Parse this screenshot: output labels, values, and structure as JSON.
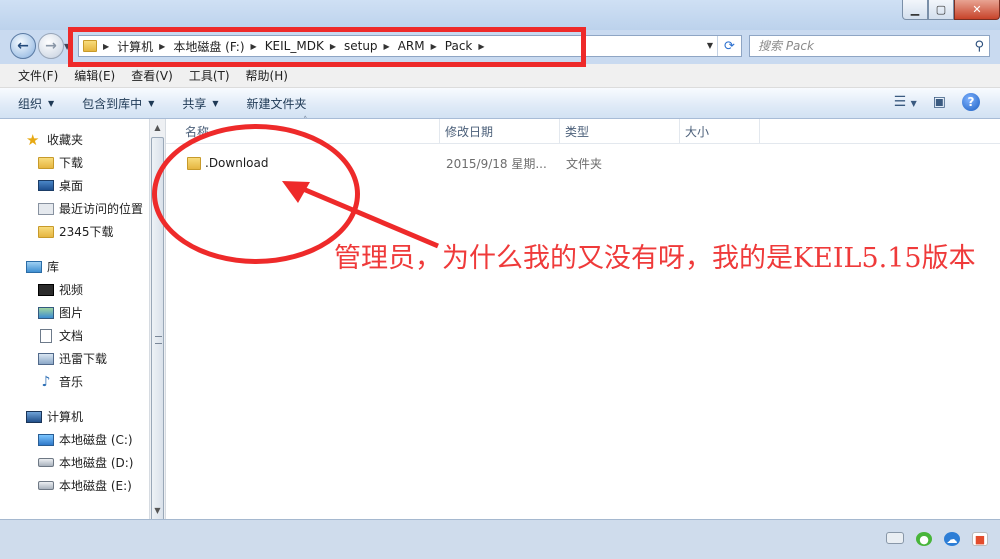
{
  "window": {
    "minimize": "▁",
    "maximize": "▢",
    "close": "✕"
  },
  "address": {
    "breadcrumbs": [
      "计算机",
      "本地磁盘 (F:)",
      "KEIL_MDK",
      "setup",
      "ARM",
      "Pack"
    ]
  },
  "search": {
    "placeholder": "搜索 Pack"
  },
  "menu": [
    "文件(F)",
    "编辑(E)",
    "查看(V)",
    "工具(T)",
    "帮助(H)"
  ],
  "toolbar": {
    "organize": "组织",
    "include_in_library": "包含到库中",
    "share": "共享",
    "new_folder": "新建文件夹",
    "help": "?"
  },
  "navpane": {
    "favorites": {
      "title": "收藏夹",
      "items": [
        "下载",
        "桌面",
        "最近访问的位置",
        "2345下载"
      ]
    },
    "libraries": {
      "title": "库",
      "items": [
        "视频",
        "图片",
        "文档",
        "迅雷下载",
        "音乐"
      ]
    },
    "computer": {
      "title": "计算机",
      "items": [
        "本地磁盘 (C:)",
        "本地磁盘 (D:)",
        "本地磁盘 (E:)"
      ]
    }
  },
  "columns": [
    "名称",
    "修改日期",
    "类型",
    "大小"
  ],
  "files": [
    {
      "name": ".Download",
      "modified": "2015/9/18 星期...",
      "type": "文件夹",
      "size": ""
    }
  ],
  "annotation": {
    "text": "管理员，为什么我的又没有呀，我的是KEIL5.15版本",
    "color": "#ef3a3a"
  }
}
